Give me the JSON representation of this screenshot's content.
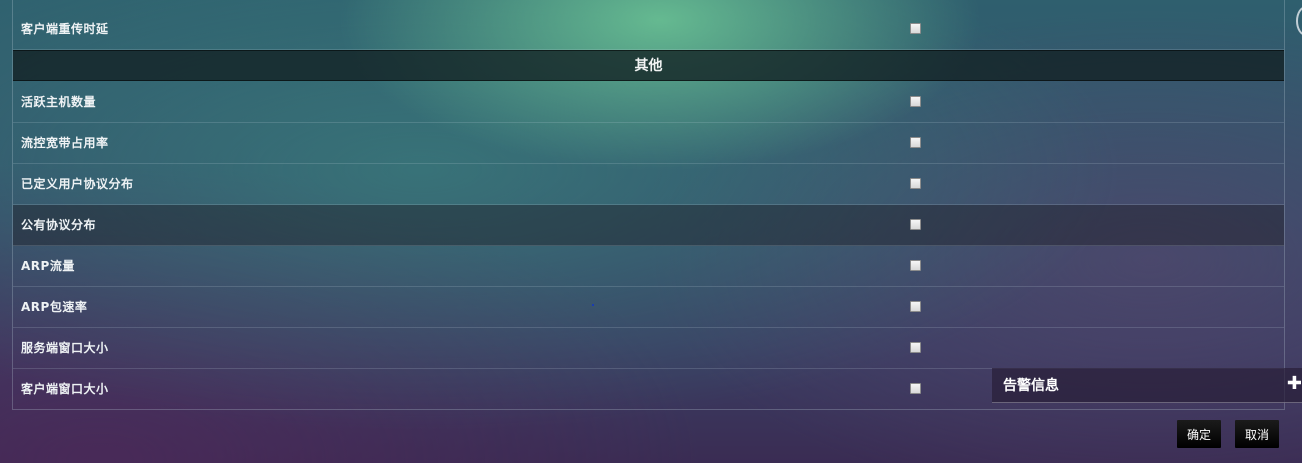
{
  "table": {
    "rows_top": [
      {
        "label": "客户端重传时延",
        "checked": false
      }
    ],
    "section_title": "其他",
    "rows": [
      {
        "label": "活跃主机数量",
        "checked": false
      },
      {
        "label": "流控宽带占用率",
        "checked": false
      },
      {
        "label": "已定义用户协议分布",
        "checked": false
      },
      {
        "label": "公有协议分布",
        "checked": false
      },
      {
        "label": "ARP流量",
        "checked": false
      },
      {
        "label": "ARP包速率",
        "checked": false
      },
      {
        "label": "服务端窗口大小",
        "checked": false
      },
      {
        "label": "客户端窗口大小",
        "checked": false
      }
    ]
  },
  "alert_panel": {
    "title": "告警信息",
    "expand_icon": "plus-icon"
  },
  "buttons": {
    "confirm": "确定",
    "cancel": "取消"
  }
}
